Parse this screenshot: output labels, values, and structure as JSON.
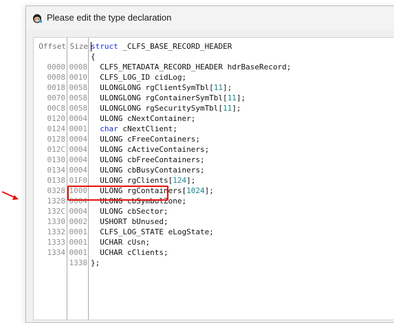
{
  "window": {
    "title": "Please edit the type declaration",
    "icon": "app-icon"
  },
  "columns": {
    "offset_header": "Offset",
    "size_header": "Size"
  },
  "rows": [
    {
      "offset": "",
      "size": "",
      "kw": "struct",
      "text": " _CLFS_BASE_RECORD_HEADER",
      "lit": "",
      "tail": ""
    },
    {
      "offset": "",
      "size": "",
      "kw": "",
      "text": "{",
      "lit": "",
      "tail": ""
    },
    {
      "offset": "0000",
      "size": "0008",
      "kw": "",
      "text": "  CLFS_METADATA_RECORD_HEADER hdrBaseRecord;",
      "lit": "",
      "tail": ""
    },
    {
      "offset": "0008",
      "size": "0010",
      "kw": "",
      "text": "  CLFS_LOG_ID cidLog;",
      "lit": "",
      "tail": ""
    },
    {
      "offset": "0018",
      "size": "0058",
      "kw": "",
      "text": "  ULONGLONG rgClientSymTbl[",
      "lit": "11",
      "tail": "];"
    },
    {
      "offset": "0070",
      "size": "0058",
      "kw": "",
      "text": "  ULONGLONG rgContainerSymTbl[",
      "lit": "11",
      "tail": "];"
    },
    {
      "offset": "00C8",
      "size": "0058",
      "kw": "",
      "text": "  ULONGLONG rgSecuritySymTbl[",
      "lit": "11",
      "tail": "];"
    },
    {
      "offset": "0120",
      "size": "0004",
      "kw": "",
      "text": "  ULONG cNextContainer;",
      "lit": "",
      "tail": ""
    },
    {
      "offset": "0124",
      "size": "0001",
      "kw": "char",
      "text": " cNextClient;",
      "lit": "",
      "tail": ""
    },
    {
      "offset": "0128",
      "size": "0004",
      "kw": "",
      "text": "  ULONG cFreeContainers;",
      "lit": "",
      "tail": ""
    },
    {
      "offset": "012C",
      "size": "0004",
      "kw": "",
      "text": "  ULONG cActiveContainers;",
      "lit": "",
      "tail": ""
    },
    {
      "offset": "0130",
      "size": "0004",
      "kw": "",
      "text": "  ULONG cbFreeContainers;",
      "lit": "",
      "tail": ""
    },
    {
      "offset": "0134",
      "size": "0004",
      "kw": "",
      "text": "  ULONG cbBusyContainers;",
      "lit": "",
      "tail": ""
    },
    {
      "offset": "0138",
      "size": "01F0",
      "kw": "",
      "text": "  ULONG rgClients[",
      "lit": "124",
      "tail": "];"
    },
    {
      "offset": "0328",
      "size": "1000",
      "kw": "",
      "text": "  ULONG rgContainers[",
      "lit": "1024",
      "tail": "];"
    },
    {
      "offset": "1328",
      "size": "0004",
      "kw": "",
      "text": "  ULONG cbSymbolZone;",
      "lit": "",
      "tail": ""
    },
    {
      "offset": "132C",
      "size": "0004",
      "kw": "",
      "text": "  ULONG cbSector;",
      "lit": "",
      "tail": ""
    },
    {
      "offset": "1330",
      "size": "0002",
      "kw": "",
      "text": "  USHORT bUnused;",
      "lit": "",
      "tail": ""
    },
    {
      "offset": "1332",
      "size": "0001",
      "kw": "",
      "text": "  CLFS_LOG_STATE eLogState;",
      "lit": "",
      "tail": ""
    },
    {
      "offset": "1333",
      "size": "0001",
      "kw": "",
      "text": "  UCHAR cUsn;",
      "lit": "",
      "tail": ""
    },
    {
      "offset": "1334",
      "size": "0001",
      "kw": "",
      "text": "  UCHAR cClients;",
      "lit": "",
      "tail": ""
    },
    {
      "offset": "",
      "size": "1338",
      "kw": "",
      "text": "};",
      "lit": "",
      "tail": ""
    }
  ],
  "annotation": {
    "highlighted_row": "1328",
    "box_color": "#e3120b",
    "arrow_color": "#e3120b"
  },
  "colors": {
    "keyword": "#1c2fd8",
    "literal": "#14868c",
    "gutter_text": "#909090"
  }
}
